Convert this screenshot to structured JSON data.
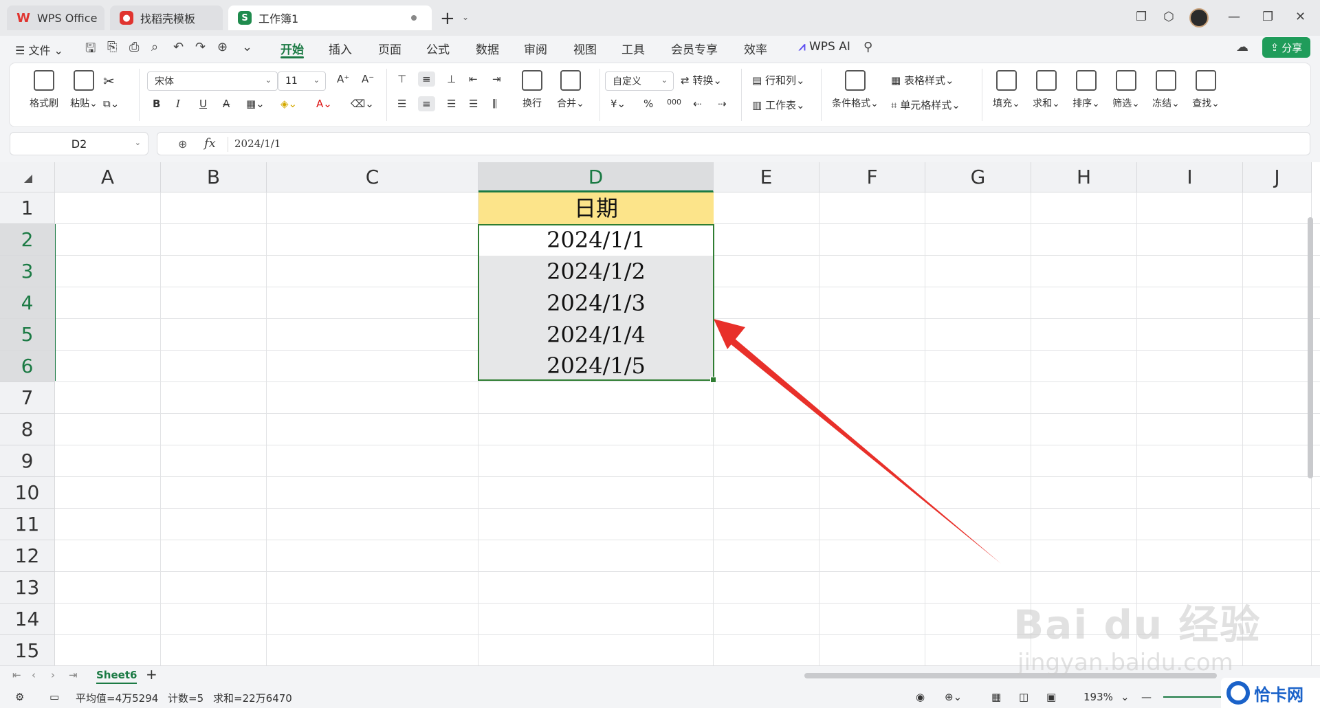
{
  "tabs": [
    {
      "label": "WPS Office",
      "icon": "wps-logo-icon"
    },
    {
      "label": "找稻壳模板",
      "icon": "docer-icon"
    },
    {
      "label": "工作簿1",
      "icon": "spreadsheet-icon"
    }
  ],
  "menu": {
    "file": "文件",
    "items": [
      "开始",
      "插入",
      "页面",
      "公式",
      "数据",
      "审阅",
      "视图",
      "工具",
      "会员专享",
      "效率"
    ],
    "active": "开始",
    "wps_ai": "WPS AI",
    "share": "分享"
  },
  "ribbon": {
    "format_painter": "格式刷",
    "paste": "粘贴",
    "font_name": "宋体",
    "font_size": "11",
    "wrap": "换行",
    "merge": "合并",
    "number_format": "自定义",
    "convert": "转换",
    "row_col": "行和列",
    "worksheet": "工作表",
    "cond_format": "条件格式",
    "table_style": "表格样式",
    "cell_style": "单元格样式",
    "fill": "填充",
    "sum": "求和",
    "sort": "排序",
    "filter": "筛选",
    "freeze": "冻结",
    "find": "查找",
    "bold": "B",
    "italic": "I",
    "underline": "U",
    "strike": "A",
    "yuan": "¥",
    "percent": "%",
    "thousands": "000"
  },
  "formula_bar": {
    "name_box": "D2",
    "fx": "fx",
    "value": "2024/1/1"
  },
  "columns": [
    "A",
    "B",
    "C",
    "D",
    "E",
    "F",
    "G",
    "H",
    "I",
    "J"
  ],
  "rows": [
    "1",
    "2",
    "3",
    "4",
    "5",
    "6",
    "7",
    "8",
    "9",
    "10",
    "11",
    "12",
    "13",
    "14",
    "15"
  ],
  "cells": {
    "D1": "日期",
    "D2": "2024/1/1",
    "D3": "2024/1/2",
    "D4": "2024/1/3",
    "D5": "2024/1/4",
    "D6": "2024/1/5"
  },
  "sheets": {
    "active": "Sheet6"
  },
  "status": {
    "average": "平均值=4万5294",
    "count": "计数=5",
    "sum": "求和=22万6470",
    "zoom": "193%"
  },
  "watermark": {
    "brand": "Bai du 经验",
    "url": "jingyan.baidu.com",
    "corner": "恰卡网"
  },
  "colors": {
    "accent": "#1b7a44",
    "header_fill": "#fce48a",
    "selection_border": "#2f7d32",
    "arrow": "#e8302a"
  }
}
